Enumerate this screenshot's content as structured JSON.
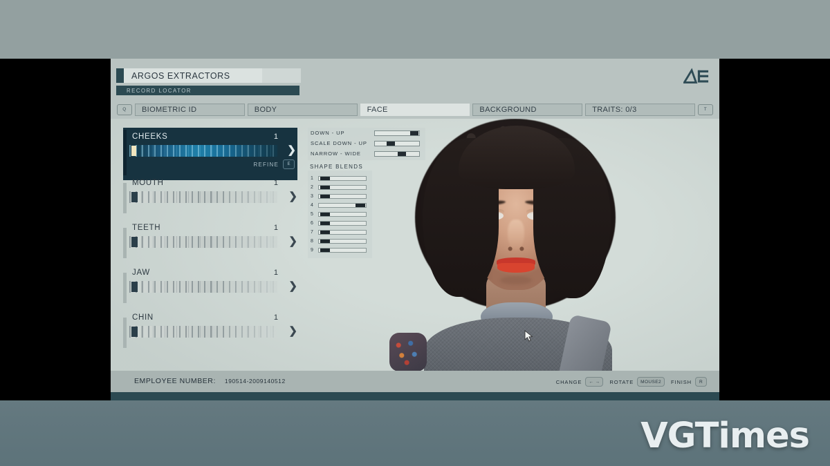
{
  "header": {
    "title": "ARGOS EXTRACTORS",
    "subtitle": "RECORD LOCATOR",
    "logo_alt": "ae-monogram-logo"
  },
  "tabbar": {
    "left_key": "Q",
    "right_key": "T",
    "tabs": [
      {
        "label": "BIOMETRIC ID",
        "active": false
      },
      {
        "label": "BODY",
        "active": false
      },
      {
        "label": "FACE",
        "active": true
      },
      {
        "label": "BACKGROUND",
        "active": false
      },
      {
        "label": "TRAITS: 0/3",
        "active": false
      }
    ]
  },
  "categories": [
    {
      "name": "CHEEKS",
      "value": "1",
      "selected": true,
      "handle_pct": 1.5,
      "refine_label": "REFINE",
      "refine_key": "E"
    },
    {
      "name": "MOUTH",
      "value": "1",
      "selected": false,
      "handle_pct": 1.5
    },
    {
      "name": "TEETH",
      "value": "1",
      "selected": false,
      "handle_pct": 1.5
    },
    {
      "name": "JAW",
      "value": "1",
      "selected": false,
      "handle_pct": 1.5
    },
    {
      "name": "CHIN",
      "value": "1",
      "selected": false,
      "handle_pct": 1.5
    }
  ],
  "axis_sliders": [
    {
      "label": "DOWN - UP",
      "fill_start_pct": 79,
      "fill_width_pct": 19
    },
    {
      "label": "SCALE DOWN - UP",
      "fill_start_pct": 26,
      "fill_width_pct": 19
    },
    {
      "label": "NARROW - WIDE",
      "fill_start_pct": 51,
      "fill_width_pct": 19
    }
  ],
  "shape_blends": {
    "title": "SHAPE BLENDS",
    "rows": [
      {
        "num": "1",
        "handle_pct": 3
      },
      {
        "num": "2",
        "handle_pct": 3
      },
      {
        "num": "3",
        "handle_pct": 3
      },
      {
        "num": "4",
        "handle_pct": 78
      },
      {
        "num": "5",
        "handle_pct": 3
      },
      {
        "num": "6",
        "handle_pct": 3
      },
      {
        "num": "7",
        "handle_pct": 3
      },
      {
        "num": "8",
        "handle_pct": 3
      },
      {
        "num": "9",
        "handle_pct": 3
      }
    ]
  },
  "footer": {
    "employee_label": "EMPLOYEE NUMBER:",
    "employee_value": "190514-2009140512",
    "hints": [
      {
        "label": "CHANGE",
        "key": "← →"
      },
      {
        "label": "ROTATE",
        "key": "MOUSE2"
      },
      {
        "label": "FINISH",
        "key": "R"
      }
    ]
  },
  "watermark": {
    "text": "VGTimes"
  },
  "colors": {
    "panel": "#c2cbc9",
    "header": "#b9c3c1",
    "accent_dark": "#2c4a52",
    "selected_bg": "#173340",
    "selected_slider": "#1f7fa8",
    "handle_selected": "#f0e6c0",
    "text": "#2e3a42",
    "lips": "#d8442f"
  }
}
